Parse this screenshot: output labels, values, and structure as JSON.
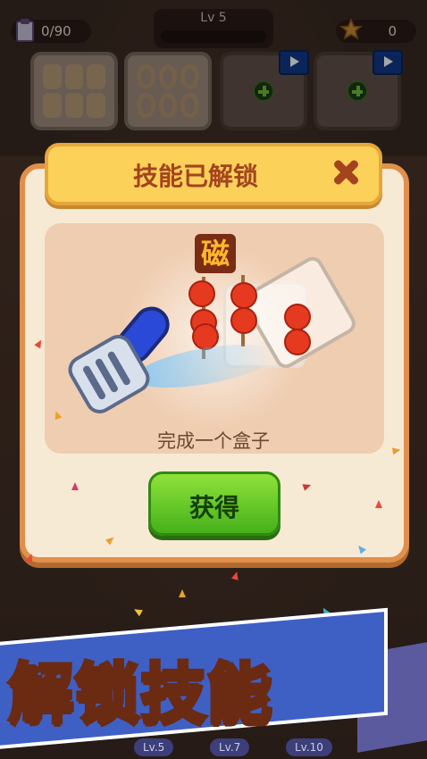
{
  "hud": {
    "orders_progress": "0/90",
    "level": "Lv 5",
    "stars": "0"
  },
  "slots": [
    {
      "state": "filled",
      "icon": "skewer-tray-icon"
    },
    {
      "state": "filled",
      "icon": "ring-tray-icon"
    },
    {
      "state": "locked",
      "icon": "plus-icon",
      "badge": "video-ad-icon"
    },
    {
      "state": "locked",
      "icon": "plus-icon",
      "badge": "video-ad-icon"
    }
  ],
  "modal": {
    "title": "技能已解锁",
    "skill_badge": "磁",
    "caption": "完成一个盒子",
    "confirm_label": "获得"
  },
  "banner": {
    "text": "解锁技能"
  },
  "bottom_tags": [
    "Lv.5",
    "Lv.7",
    "Lv.10"
  ],
  "colors": {
    "modal_border": "#e0904a",
    "title_bar": "#fbd15a",
    "title_text": "#a4441f",
    "button_green": "#45b11a",
    "banner_text": "#ffd23a",
    "banner_ribbon": "#3e60c4"
  }
}
